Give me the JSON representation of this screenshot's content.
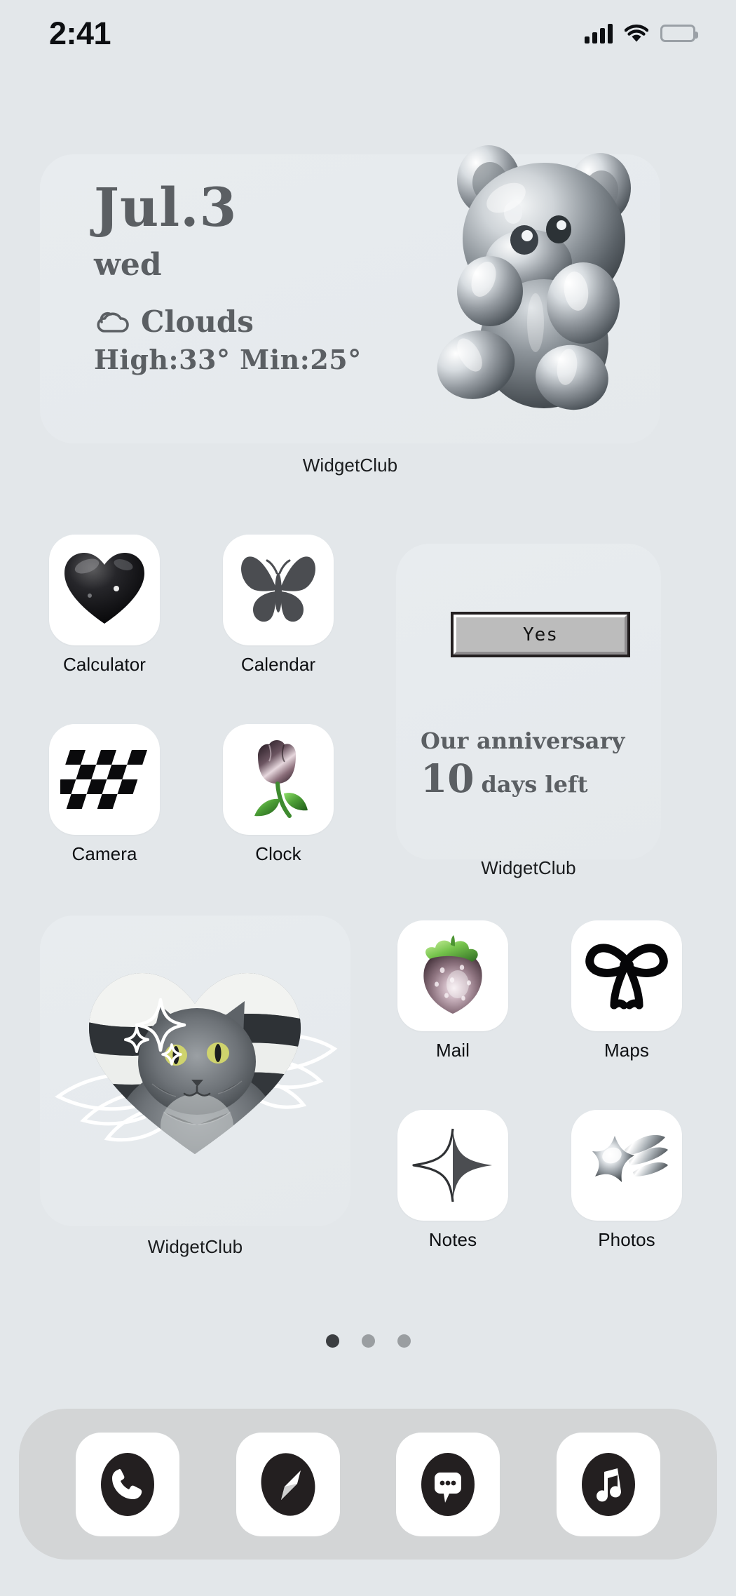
{
  "status_bar": {
    "time": "2:41",
    "icons": [
      "cellular-signal-icon",
      "wifi-icon",
      "battery-icon"
    ],
    "battery_level": 100
  },
  "theme": {
    "wallpaper_color": "#e3e7ea",
    "widget_card_color": "#e8ecef",
    "dock_color": "#d3d5d6",
    "icon_tile_color": "#ffffff",
    "label_color": "#0d0f12",
    "widget_text_color": "#5b5f63"
  },
  "widgets": {
    "weather": {
      "date": "Jul.3",
      "weekday": "wed",
      "condition": "Clouds",
      "condition_icon": "cloud-icon",
      "temps": "High:33° Min:25°",
      "art": "metallic-teddy-bear",
      "label": "WidgetClub"
    },
    "anniversary": {
      "button_label": "Yes",
      "title": "Our anniversary",
      "count": "10",
      "unit": "days left",
      "label": "WidgetClub"
    },
    "photo": {
      "art": "heart-cropped-cat-photo-with-angel-wings",
      "label": "WidgetClub"
    }
  },
  "apps": [
    {
      "name": "Calculator",
      "icon": "black-glossy-heart-icon"
    },
    {
      "name": "Calendar",
      "icon": "butterfly-icon"
    },
    {
      "name": "Camera",
      "icon": "checkerboard-icon"
    },
    {
      "name": "Clock",
      "icon": "tulip-flower-icon"
    },
    {
      "name": "Mail",
      "icon": "metallic-strawberry-icon"
    },
    {
      "name": "Maps",
      "icon": "black-ribbon-bow-icon"
    },
    {
      "name": "Notes",
      "icon": "four-point-sparkle-icon"
    },
    {
      "name": "Photos",
      "icon": "metallic-shooting-star-icon"
    }
  ],
  "dock": [
    {
      "name": "Phone",
      "icon": "phone-handset-icon"
    },
    {
      "name": "Safari",
      "icon": "compass-icon"
    },
    {
      "name": "Messages",
      "icon": "chat-bubble-icon"
    },
    {
      "name": "Music",
      "icon": "music-note-icon"
    }
  ],
  "page_indicator": {
    "total": 3,
    "active": 1
  }
}
